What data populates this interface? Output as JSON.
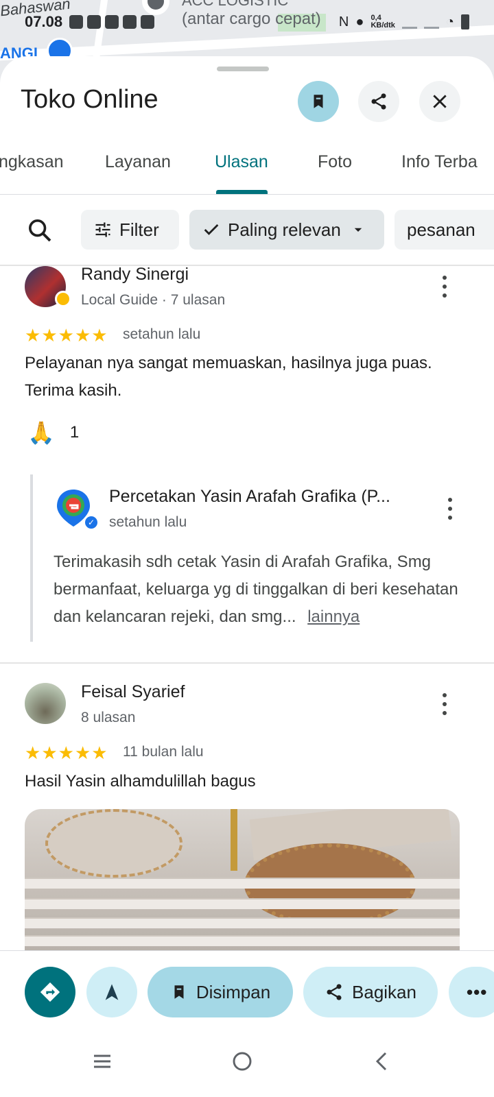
{
  "status_bar": {
    "time": "07.08",
    "speed": "0,4",
    "speed_unit": "KB/dtk"
  },
  "map": {
    "label_1": "Bahaswan",
    "label_2": "ACC LOGISTIC",
    "label_3": "(antar cargo cepat)",
    "label_4": "ANGI"
  },
  "header": {
    "title": "Toko Online"
  },
  "tabs": [
    {
      "label": "ngkasan"
    },
    {
      "label": "Layanan"
    },
    {
      "label": "Ulasan"
    },
    {
      "label": "Foto"
    },
    {
      "label": "Info Terba"
    }
  ],
  "filters": {
    "filter_label": "Filter",
    "sort_label": "Paling relevan",
    "chip_label": "pesanan"
  },
  "reviews": [
    {
      "name": "Randy Sinergi",
      "meta": "Local Guide · 7 ulasan",
      "rating": 5,
      "time": "setahun lalu",
      "text": "Pelayanan nya sangat memuaskan, hasilnya juga puas. Terima kasih.",
      "reaction_emoji": "🙏",
      "reaction_count": "1",
      "owner_reply": {
        "name": "Percetakan Yasin Arafah Grafika (P...",
        "time": "setahun lalu",
        "text": "Terimakasih sdh cetak Yasin di Arafah Grafika, Smg bermanfaat, keluarga yg di tinggalkan di beri kesehatan dan kelancaran rejeki, dan smg...",
        "more": "lainnya"
      }
    },
    {
      "name": "Feisal Syarief",
      "meta": "8 ulasan",
      "rating": 5,
      "time": "11 bulan lalu",
      "text": "Hasil Yasin alhamdulillah bagus"
    }
  ],
  "actions": {
    "saved": "Disimpan",
    "share": "Bagikan"
  },
  "colors": {
    "accent": "#00727d",
    "star": "#fbbc04",
    "chip_active": "#a4d8e6"
  }
}
